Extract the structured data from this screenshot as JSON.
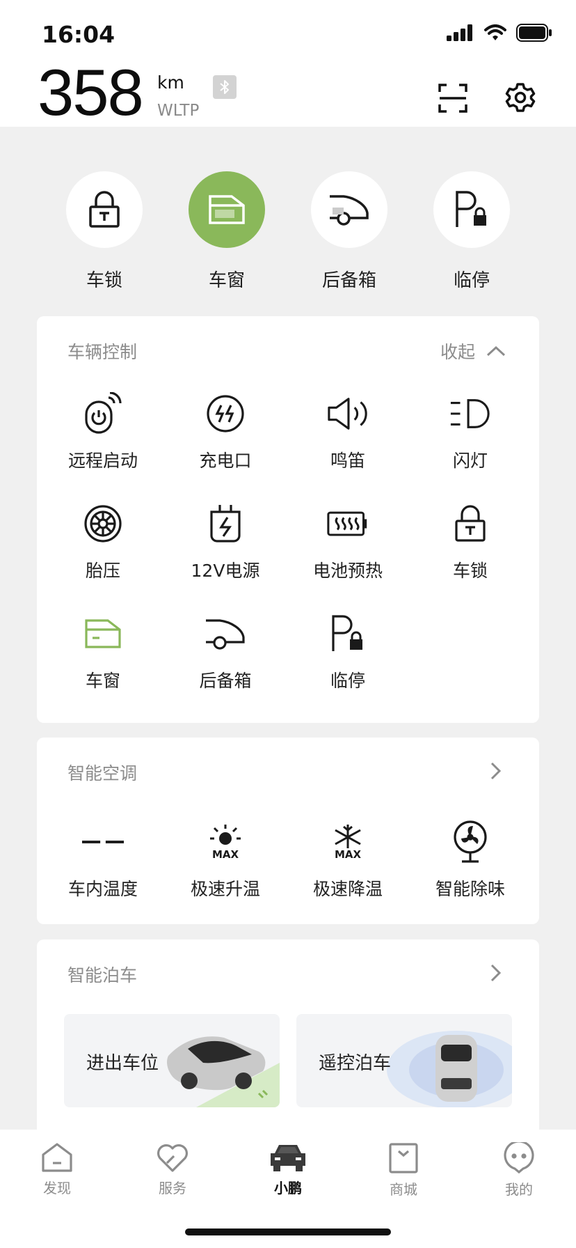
{
  "status_bar": {
    "time": "16:04"
  },
  "header": {
    "range_value": "358",
    "range_unit": "km",
    "range_standard": "WLTP"
  },
  "quick_controls": [
    {
      "label": "车锁",
      "icon": "lock-icon",
      "active": false
    },
    {
      "label": "车窗",
      "icon": "window-icon",
      "active": true
    },
    {
      "label": "后备箱",
      "icon": "trunk-icon",
      "active": false
    },
    {
      "label": "临停",
      "icon": "parking-lock-icon",
      "active": false
    }
  ],
  "vehicle_control": {
    "title": "车辆控制",
    "collapse_label": "收起",
    "items": [
      {
        "label": "远程启动",
        "icon": "remote-start-icon"
      },
      {
        "label": "充电口",
        "icon": "charge-port-icon"
      },
      {
        "label": "鸣笛",
        "icon": "horn-icon"
      },
      {
        "label": "闪灯",
        "icon": "flash-light-icon"
      },
      {
        "label": "胎压",
        "icon": "tire-pressure-icon"
      },
      {
        "label": "12V电源",
        "icon": "power-12v-icon"
      },
      {
        "label": "电池预热",
        "icon": "battery-preheat-icon"
      },
      {
        "label": "车锁",
        "icon": "lock-icon"
      },
      {
        "label": "车窗",
        "icon": "window-icon"
      },
      {
        "label": "后备箱",
        "icon": "trunk-icon"
      },
      {
        "label": "临停",
        "icon": "parking-lock-icon"
      }
    ]
  },
  "climate": {
    "title": "智能空调",
    "items": [
      {
        "label": "车内温度",
        "value": "– –"
      },
      {
        "label": "极速升温",
        "badge": "MAX"
      },
      {
        "label": "极速降温",
        "badge": "MAX"
      },
      {
        "label": "智能除味",
        "icon": "fan-icon"
      }
    ]
  },
  "parking": {
    "title": "智能泊车",
    "cards": [
      {
        "label": "进出车位"
      },
      {
        "label": "遥控泊车"
      }
    ]
  },
  "tabs": [
    {
      "label": "发现",
      "icon": "home-icon",
      "active": false
    },
    {
      "label": "服务",
      "icon": "heart-icon",
      "active": false
    },
    {
      "label": "小鹏",
      "icon": "car-icon",
      "active": true
    },
    {
      "label": "商城",
      "icon": "shopping-bag-icon",
      "active": false
    },
    {
      "label": "我的",
      "icon": "profile-icon",
      "active": false
    }
  ],
  "colors": {
    "accent_green": "#8ab85a",
    "background": "#f0f0f0"
  }
}
